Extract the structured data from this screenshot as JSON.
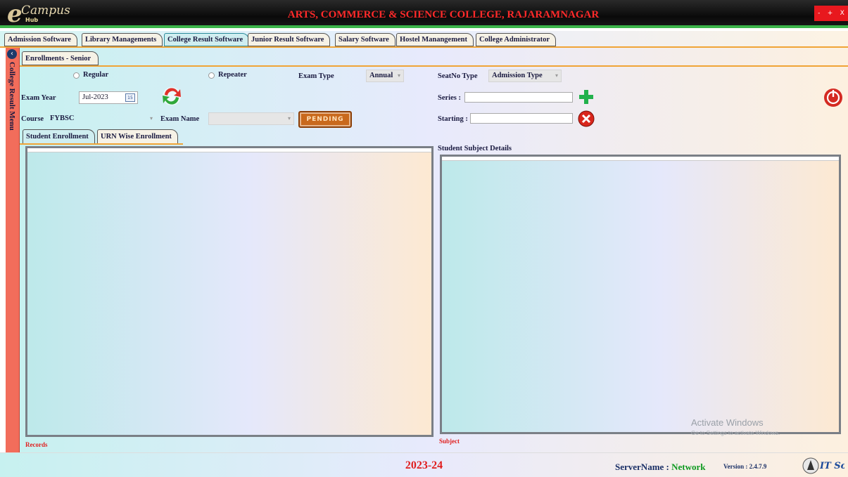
{
  "app": {
    "logo_text": "Campus",
    "logo_e": "e",
    "logo_sub": "Hub",
    "college_title": "ARTS, COMMERCE & SCIENCE COLLEGE, RAJARAMNAGAR",
    "window_controls": [
      "-",
      "+",
      "X"
    ]
  },
  "module_tabs": [
    {
      "label": "Admission Software",
      "active": false
    },
    {
      "label": "Library Managements",
      "active": false
    },
    {
      "label": "College Result Software",
      "active": true
    },
    {
      "label": "Junior Result Software",
      "active": false
    },
    {
      "label": "Salary Software",
      "active": false
    },
    {
      "label": "Hostel Manangement",
      "active": false
    },
    {
      "label": "College Administrator",
      "active": false
    }
  ],
  "sidebar": {
    "label": "College Result Menu",
    "collapse_icon": "chevron-left-icon"
  },
  "sub_tab": "Enrollments - Senior",
  "form": {
    "regular_label": "Regular",
    "repeater_label": "Repeater",
    "exam_type_label": "Exam Type",
    "exam_type_value": "Annual",
    "seatno_type_label": "SeatNo Type",
    "seatno_type_value": "Admission Type",
    "exam_year_label": "Exam Year",
    "exam_year_value": "Jul-2023",
    "calendar_day": "15",
    "series_label": "Series :",
    "starting_label": "Starting :",
    "course_label": "Course",
    "course_value": "FYBSC",
    "exam_name_label": "Exam Name",
    "exam_name_value": "",
    "pending_label": "PENDING"
  },
  "enrollment_tabs": [
    {
      "label": "Student Enrollment",
      "active": true
    },
    {
      "label": "URN Wise Enrollment",
      "active": false
    }
  ],
  "panels": {
    "right_title": "Student Subject Details",
    "left_footer": "Records",
    "right_footer": "Subject"
  },
  "watermark": {
    "title": "Activate Windows",
    "subtitle": "Go to Settings to activate Windows."
  },
  "status": {
    "session": "2023-24",
    "server_label": "ServerName : ",
    "server_value": "Network",
    "version": "Version : 2.4.7.9",
    "brand": "IT Soft"
  },
  "colors": {
    "title_red": "#ff2a2a",
    "accent_orange": "#f0a436",
    "sidebar": "#f26d5b",
    "add_green": "#22b14c",
    "close_red": "#d9261c"
  }
}
